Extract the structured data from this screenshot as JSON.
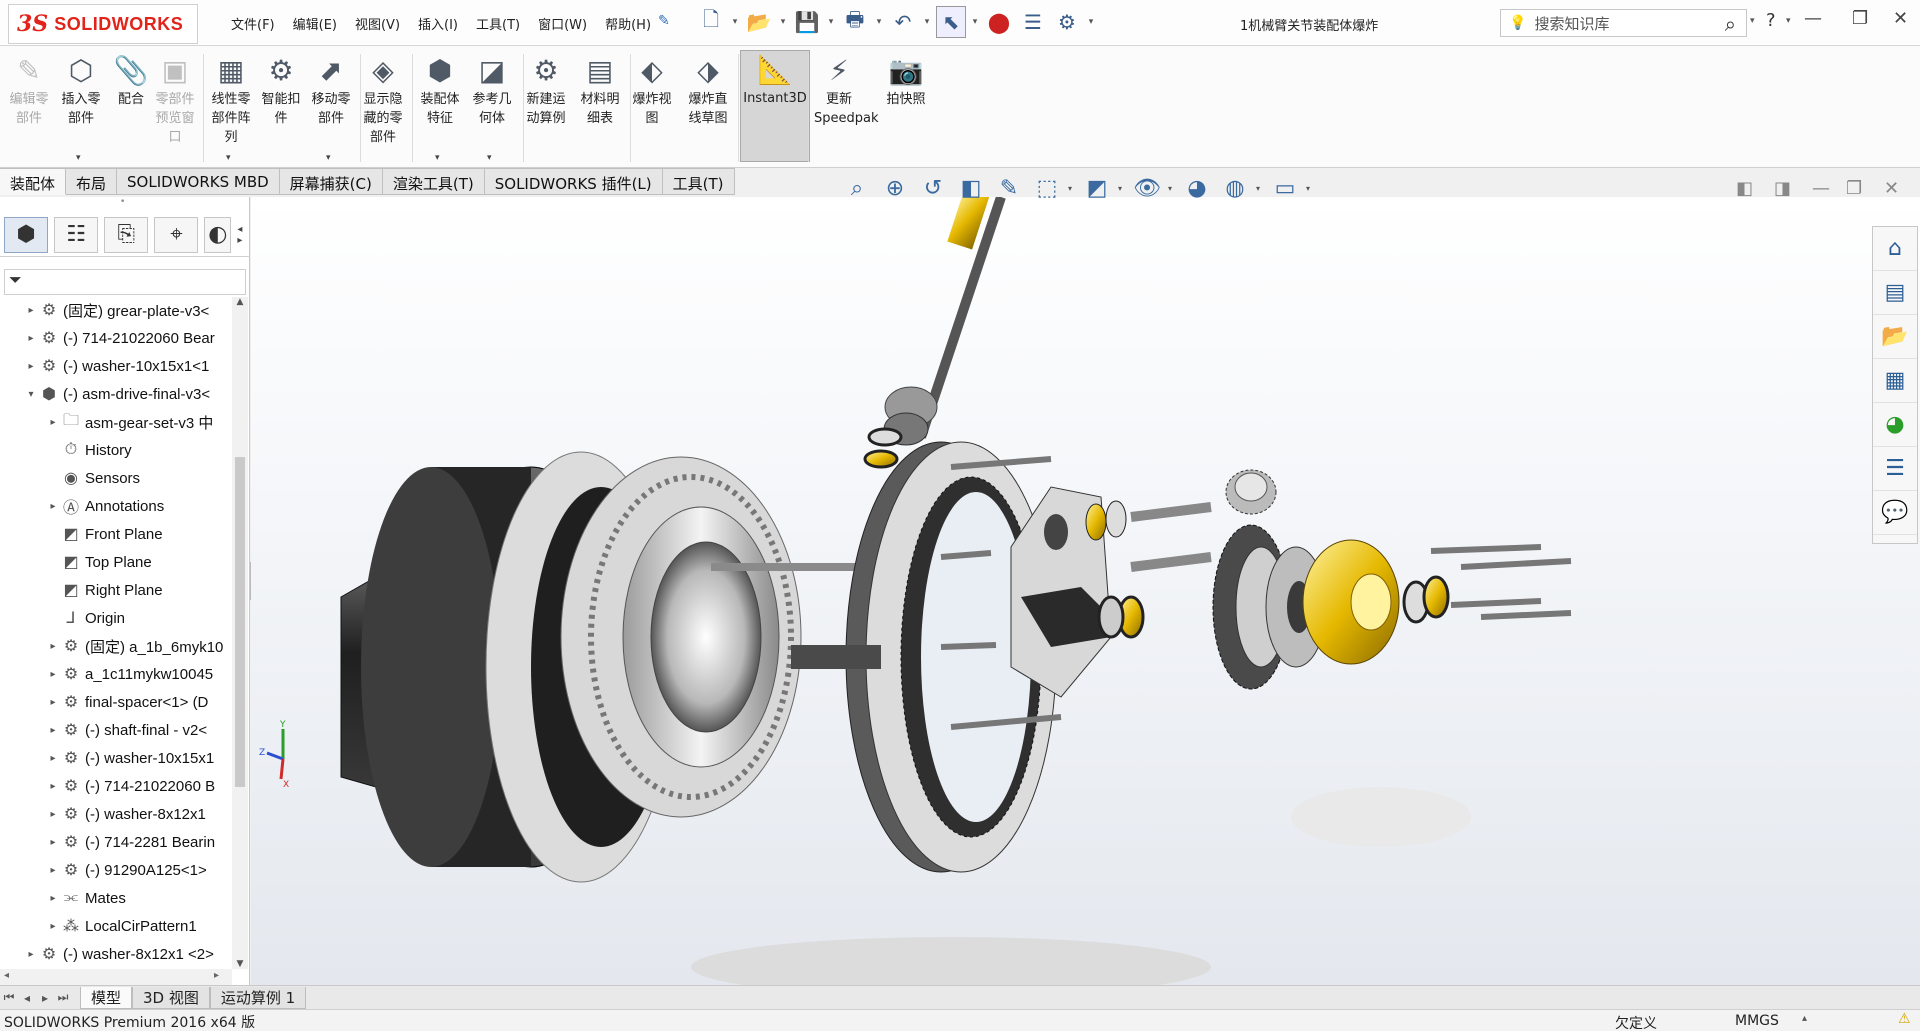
{
  "app": {
    "logo_ds": "3S",
    "logo_name": "SOLIDWORKS",
    "document_title": "1机械臂关节装配体爆炸"
  },
  "menus": [
    "文件(F)",
    "编辑(E)",
    "视图(V)",
    "插入(I)",
    "工具(T)",
    "窗口(W)",
    "帮助(H)"
  ],
  "search": {
    "placeholder": "搜索知识库"
  },
  "help_label": "?",
  "ribbon": [
    {
      "label": "编辑零部件",
      "icon": "edit-component-icon",
      "enabled": false
    },
    {
      "label": "插入零部件",
      "icon": "insert-components-icon",
      "enabled": true,
      "dropdown": true
    },
    {
      "label": "配合",
      "icon": "mate-icon",
      "enabled": true
    },
    {
      "label": "零部件预览窗口",
      "icon": "component-preview-icon",
      "enabled": false
    },
    {
      "label": "线性零部件阵列",
      "icon": "linear-pattern-icon",
      "enabled": true,
      "dropdown": true
    },
    {
      "label": "智能扣件",
      "icon": "smart-fasteners-icon",
      "enabled": true
    },
    {
      "label": "移动零部件",
      "icon": "move-component-icon",
      "enabled": true,
      "dropdown": true
    },
    {
      "label": "显示隐藏的零部件",
      "icon": "show-hidden-icon",
      "enabled": true
    },
    {
      "label": "装配体特征",
      "icon": "assembly-features-icon",
      "enabled": true,
      "dropdown": true
    },
    {
      "label": "参考几何体",
      "icon": "reference-geometry-icon",
      "enabled": true,
      "dropdown": true
    },
    {
      "label": "新建运动算例",
      "icon": "new-motion-study-icon",
      "enabled": true
    },
    {
      "label": "材料明细表",
      "icon": "bom-icon",
      "enabled": true
    },
    {
      "label": "爆炸视图",
      "icon": "exploded-view-icon",
      "enabled": true
    },
    {
      "label": "爆炸直线草图",
      "icon": "explode-line-sketch-icon",
      "enabled": true
    },
    {
      "label": "Instant3D",
      "icon": "instant3d-icon",
      "enabled": true,
      "active": true
    },
    {
      "label": "更新Speedpak",
      "icon": "speedpak-icon",
      "enabled": true
    },
    {
      "label": "拍快照",
      "icon": "snapshot-icon",
      "enabled": true
    }
  ],
  "command_tabs": [
    "装配体",
    "布局",
    "SOLIDWORKS MBD",
    "屏幕捕获(C)",
    "渲染工具(T)",
    "SOLIDWORKS 插件(L)",
    "工具(T)"
  ],
  "tree": [
    {
      "label": "(固定) grear-plate-v3<",
      "level": 1,
      "expand": "▸",
      "icon": "part-icon"
    },
    {
      "label": "(-) 714-21022060 Bear",
      "level": 1,
      "expand": "▸",
      "icon": "part-icon"
    },
    {
      "label": "(-) washer-10x15x1<1",
      "level": 1,
      "expand": "▸",
      "icon": "part-icon"
    },
    {
      "label": "(-) asm-drive-final-v3<",
      "level": 1,
      "expand": "▾",
      "icon": "assembly-icon"
    },
    {
      "label": "asm-gear-set-v3 中",
      "level": 2,
      "expand": "▸",
      "icon": "folder-icon"
    },
    {
      "label": "History",
      "level": 2,
      "expand": "",
      "icon": "history-icon"
    },
    {
      "label": "Sensors",
      "level": 2,
      "expand": "",
      "icon": "sensor-icon"
    },
    {
      "label": "Annotations",
      "level": 2,
      "expand": "▸",
      "icon": "annotation-icon"
    },
    {
      "label": "Front Plane",
      "level": 2,
      "expand": "",
      "icon": "plane-icon"
    },
    {
      "label": "Top Plane",
      "level": 2,
      "expand": "",
      "icon": "plane-icon"
    },
    {
      "label": "Right Plane",
      "level": 2,
      "expand": "",
      "icon": "plane-icon"
    },
    {
      "label": "Origin",
      "level": 2,
      "expand": "",
      "icon": "origin-icon"
    },
    {
      "label": "(固定) a_1b_6myk10",
      "level": 2,
      "expand": "▸",
      "icon": "part-icon"
    },
    {
      "label": "a_1c11mykw10045",
      "level": 2,
      "expand": "▸",
      "icon": "part-icon"
    },
    {
      "label": "final-spacer<1> (D",
      "level": 2,
      "expand": "▸",
      "icon": "part-icon"
    },
    {
      "label": "(-) shaft-final - v2<",
      "level": 2,
      "expand": "▸",
      "icon": "part-icon"
    },
    {
      "label": "(-) washer-10x15x1",
      "level": 2,
      "expand": "▸",
      "icon": "part-icon"
    },
    {
      "label": "(-) 714-21022060 B",
      "level": 2,
      "expand": "▸",
      "icon": "part-icon"
    },
    {
      "label": "(-) washer-8x12x1",
      "level": 2,
      "expand": "▸",
      "icon": "part-icon"
    },
    {
      "label": "(-) 714-2281 Bearin",
      "level": 2,
      "expand": "▸",
      "icon": "part-icon"
    },
    {
      "label": "(-) 91290A125<1>",
      "level": 2,
      "expand": "▸",
      "icon": "part-icon"
    },
    {
      "label": "Mates",
      "level": 2,
      "expand": "▸",
      "icon": "mates-icon"
    },
    {
      "label": "LocalCirPattern1",
      "level": 2,
      "expand": "▸",
      "icon": "pattern-icon"
    },
    {
      "label": "(-) washer-8x12x1 <2>",
      "level": 1,
      "expand": "▸",
      "icon": "part-icon"
    }
  ],
  "triad": {
    "x": "X",
    "y": "Y",
    "z": "Z"
  },
  "bottom_tabs": [
    "模型",
    "3D 视图",
    "运动算例 1"
  ],
  "status": {
    "product": "SOLIDWORKS Premium 2016 x64 版",
    "state": "欠定义",
    "units": "MMGS"
  },
  "colors": {
    "brand": "#e2231a",
    "gold": "#e8c21a",
    "metal_dark": "#2b2b2b"
  }
}
